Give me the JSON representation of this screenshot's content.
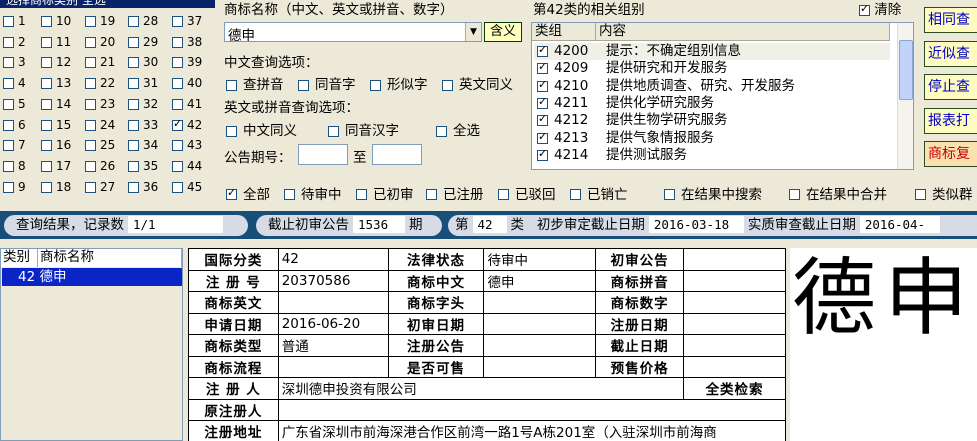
{
  "class_grid": {
    "header": "选择商标类别   全选",
    "columns": [
      [
        "1",
        "2",
        "3",
        "4",
        "5",
        "6",
        "7",
        "8",
        "9"
      ],
      [
        "10",
        "11",
        "12",
        "13",
        "14",
        "15",
        "16",
        "17",
        "18"
      ],
      [
        "19",
        "20",
        "21",
        "22",
        "23",
        "24",
        "25",
        "26",
        "27"
      ],
      [
        "28",
        "29",
        "30",
        "31",
        "32",
        "33",
        "34",
        "35",
        "36"
      ],
      [
        "37",
        "38",
        "39",
        "40",
        "41",
        "42",
        "43",
        "44",
        "45"
      ]
    ],
    "checked": [
      "42"
    ]
  },
  "query": {
    "name_label": "商标名称（中文、英文或拼音、数字）",
    "name_value": "德申",
    "contains_btn": "含义",
    "cn_options_label": "中文查询选项：",
    "cn_options": [
      "查拼音",
      "同音字",
      "形似字",
      "英文同义"
    ],
    "en_options_label": "英文或拼音查询选项：",
    "en_options": [
      "中文同义",
      "同音汉字",
      "全选"
    ],
    "gazette_label": "公告期号：",
    "gazette_to": "至",
    "gazette_from_value": "",
    "gazette_to_value": ""
  },
  "groups": {
    "title": "第42类的相关组别",
    "clear_label": "清除",
    "col_group": "类组",
    "col_content": "内容",
    "rows": [
      {
        "code": "4200",
        "desc": "提示：不确定组别信息"
      },
      {
        "code": "4209",
        "desc": "提供研究和开发服务"
      },
      {
        "code": "4210",
        "desc": "提供地质调查、研究、开发服务"
      },
      {
        "code": "4211",
        "desc": "提供化学研究服务"
      },
      {
        "code": "4212",
        "desc": "提供生物学研究服务"
      },
      {
        "code": "4213",
        "desc": "提供气象情报服务"
      },
      {
        "code": "4214",
        "desc": "提供测试服务"
      }
    ]
  },
  "right_buttons": [
    "相同查",
    "近似查",
    "停止查",
    "报表打",
    "商标复"
  ],
  "status_filters": [
    "全部",
    "待审中",
    "已初审",
    "已注册",
    "已驳回",
    "已销亡"
  ],
  "search_opts": [
    "在结果中搜索",
    "在结果中合并",
    "类似群"
  ],
  "info_bar": {
    "result_label": "查询结果，记录数",
    "result_value": "1/1",
    "deadline_label": "截止初审公告",
    "deadline_value": "1536",
    "deadline_unit": "期",
    "class_prefix": "第",
    "class_value": "42",
    "class_suffix": "类",
    "prelim_label": "初步审定截止日期",
    "prelim_value": "2016-03-18",
    "substantive_label": "实质审查截止日期",
    "substantive_value": "2016-04-"
  },
  "result_list": {
    "col_class": "类别",
    "col_name": "商标名称",
    "row_class": "42",
    "row_name": "德申"
  },
  "detail": {
    "k_class": "国际分类",
    "v_class": "42",
    "k_legal": "法律状态",
    "v_legal": "待审中",
    "k_prelim": "初审公告",
    "v_prelim": "",
    "k_regno": "注 册 号",
    "v_regno": "20370586",
    "k_cn": "商标中文",
    "v_cn": "德申",
    "k_pinyin": "商标拼音",
    "v_pinyin": "",
    "k_en": "商标英文",
    "v_en": "",
    "k_head": "商标字头",
    "v_head": "",
    "k_digit": "商标数字",
    "v_digit": "",
    "k_apply": "申请日期",
    "v_apply": "2016-06-20",
    "k_prelimdate": "初审日期",
    "v_prelimdate": "",
    "k_regdate": "注册日期",
    "v_regdate": "",
    "k_type": "商标类型",
    "v_type": "普通",
    "k_reggaz": "注册公告",
    "v_reggaz": "",
    "k_expire": "截止日期",
    "v_expire": "",
    "k_flow": "商标流程",
    "v_flow": "",
    "k_sellable": "是否可售",
    "v_sellable": "",
    "k_price": "预售价格",
    "v_price": "",
    "k_registrant": "注 册 人",
    "v_registrant": "深圳德申投资有限公司",
    "full_search": "全类检索",
    "k_orig": "原注册人",
    "v_orig": "",
    "k_addr": "注册地址",
    "v_addr": "广东省深圳市前海深港合作区前湾一路1号A栋201室（入驻深圳市前海商"
  },
  "logo_text": "德申",
  "colors": {
    "info_bar_bg": "#184f7a",
    "selection": "#0a24c8",
    "button_bg": "#fdfbc0"
  }
}
